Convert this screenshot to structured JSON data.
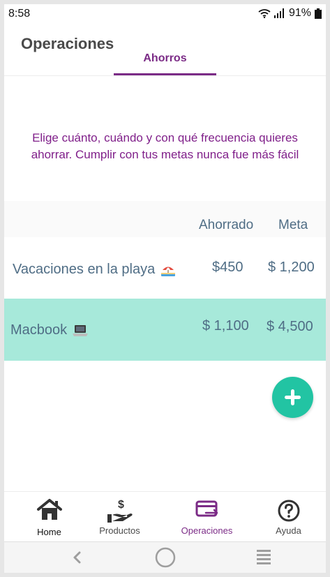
{
  "status_bar": {
    "time": "8:58",
    "battery": "91%"
  },
  "header": {
    "title": "Operaciones",
    "tab": "Ahorros"
  },
  "intro": "Elige cuánto, cuándo y con qué frecuencia quieres ahorrar. Cumplir con tus metas nunca fue más fácil",
  "table": {
    "columns": [
      "Ahorrado",
      "Meta"
    ],
    "rows": [
      {
        "name": "Vacaciones en la playa",
        "icon": "beach-umbrella-emoji",
        "saved": "$450",
        "goal": "$ 1,200"
      },
      {
        "name": "Macbook",
        "icon": "laptop-emoji",
        "saved": "$ 1,100",
        "goal": "$ 4,500"
      }
    ]
  },
  "fab": {
    "icon": "plus-icon"
  },
  "bottom_nav": {
    "items": [
      {
        "label": "Home",
        "icon": "home-icon"
      },
      {
        "label": "Productos",
        "icon": "hand-dollar-icon"
      },
      {
        "label": "Operaciones",
        "icon": "card-transfer-icon",
        "active": true
      },
      {
        "label": "Ayuda",
        "icon": "help-circle-icon"
      }
    ]
  },
  "colors": {
    "brand_purple": "#7b2b86",
    "accent_teal": "#22c4a3",
    "highlight_row": "#a7e9da",
    "text_blue_gray": "#4f6d85"
  }
}
